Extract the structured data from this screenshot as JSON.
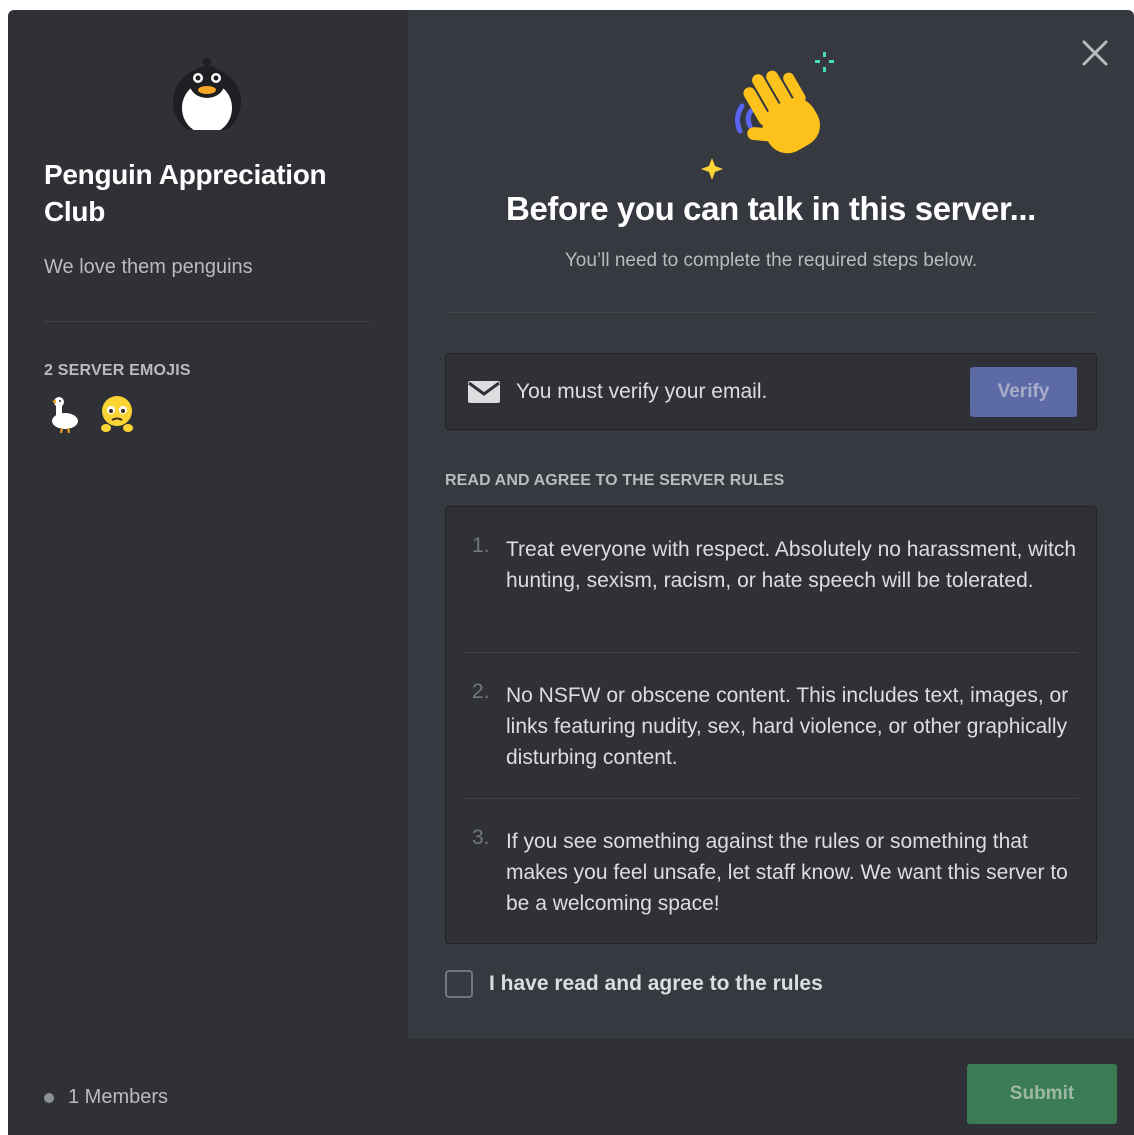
{
  "sidebar": {
    "server_name": "Penguin Appreciation Club",
    "server_description": "We love them penguins",
    "emoji_heading": "2 SERVER EMOJIS",
    "emojis": [
      "goose-emoji-icon",
      "pleading-face-emoji-icon"
    ],
    "members_label": "1 Members"
  },
  "main": {
    "hero_icon": "waving-hand-icon",
    "title": "Before you can talk in this server...",
    "subtitle": "You’ll need to complete the required steps below.",
    "verify": {
      "icon": "mail-icon",
      "text": "You must verify your email.",
      "button_label": "Verify"
    },
    "rules_heading": "READ AND AGREE TO THE SERVER RULES",
    "rules": [
      {
        "number": "1.",
        "text": "Treat everyone with respect. Absolutely no harassment, witch hunting, sexism, racism, or hate speech will be tolerated."
      },
      {
        "number": "2.",
        "text": "No NSFW or obscene content. This includes text, images, or links featuring nudity, sex, hard violence, or other graphically disturbing content."
      },
      {
        "number": "3.",
        "text": "If you see something against the rules or something that makes you feel unsafe, let staff know. We want this server to be a welcoming space!"
      }
    ],
    "agree_label": "I have read and agree to the rules",
    "agree_checked": false,
    "submit_label": "Submit"
  },
  "colors": {
    "sidebar_bg": "#2f3136",
    "main_bg": "#36393f",
    "verify_button": "#5c6ba6",
    "submit_button": "#3b7c54",
    "text_primary": "#ffffff",
    "text_muted": "#b9bbbe"
  }
}
